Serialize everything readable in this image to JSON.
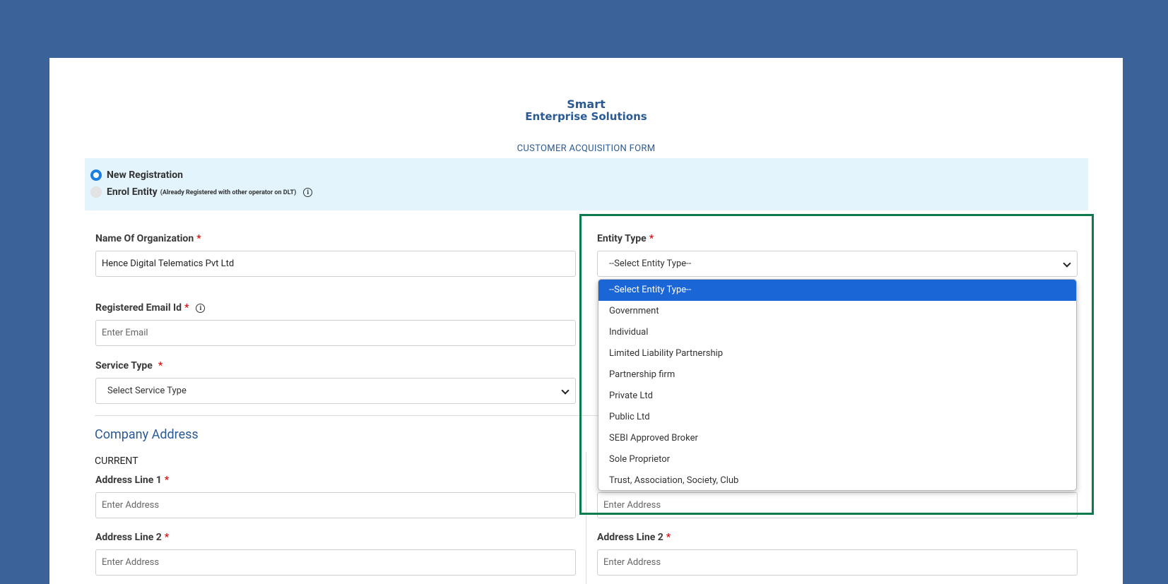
{
  "brand": {
    "line1": "Smart",
    "line2": "Enterprise Solutions"
  },
  "form_title": "CUSTOMER ACQUISITION FORM",
  "registration": {
    "option1": "New Registration",
    "option2": "Enrol Entity",
    "option2_note": "(Already Registered with other operator on DLT)"
  },
  "fields": {
    "org_name": {
      "label": "Name Of Organization",
      "value": "Hence Digital Telematics Pvt Ltd"
    },
    "entity_type": {
      "label": "Entity Type",
      "value": "--Select Entity Type--"
    },
    "email": {
      "label": "Registered Email Id",
      "placeholder": "Enter Email"
    },
    "service_type": {
      "label": "Service Type",
      "value": "Select Service Type"
    }
  },
  "company_address": {
    "title": "Company Address",
    "current_label": "CURRENT",
    "addr1_label": "Address Line 1",
    "addr2_label": "Address Line 2",
    "placeholder": "Enter Address"
  },
  "entity_dropdown": {
    "options": [
      "--Select Entity Type--",
      "Government",
      "Individual",
      "Limited Liability Partnership",
      "Partnership firm",
      "Private Ltd",
      "Public Ltd",
      "SEBI Approved Broker",
      "Sole Proprietor",
      "Trust, Association, Society, Club"
    ],
    "selected_index": 0
  },
  "colors": {
    "background": "#3b6399",
    "accent": "#1a66d6",
    "highlight_border": "#0b7a4c",
    "required": "#dd1111"
  }
}
